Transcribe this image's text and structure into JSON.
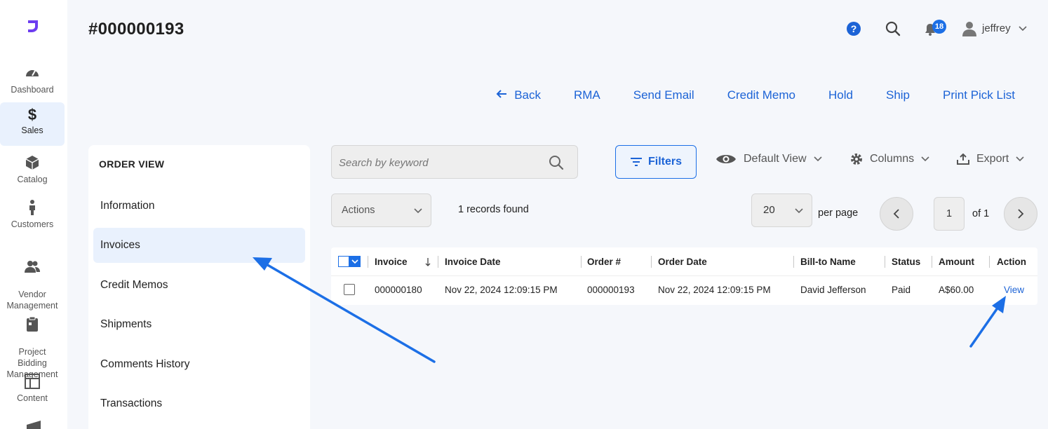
{
  "nav": {
    "items": [
      {
        "label": "Dashboard",
        "icon": "gauge-icon"
      },
      {
        "label": "Sales",
        "icon": "dollar-icon",
        "glyph": "$"
      },
      {
        "label": "Catalog",
        "icon": "box-icon"
      },
      {
        "label": "Customers",
        "icon": "person-icon"
      },
      {
        "label": "Vendor\nManagement",
        "icon": "users-icon"
      },
      {
        "label": "Project\nBidding\nManagement",
        "icon": "clipboard-icon"
      },
      {
        "label": "Content",
        "icon": "layout-icon"
      }
    ]
  },
  "header": {
    "title": "#000000193",
    "notifications_count": "18",
    "user": "jeffrey"
  },
  "actions": {
    "back": "Back",
    "rma": "RMA",
    "send_email": "Send Email",
    "credit_memo": "Credit Memo",
    "hold": "Hold",
    "ship": "Ship",
    "print_pick_list": "Print Pick List"
  },
  "side": {
    "title": "ORDER VIEW",
    "items": [
      "Information",
      "Invoices",
      "Credit Memos",
      "Shipments",
      "Comments History",
      "Transactions"
    ],
    "active": "Invoices"
  },
  "toolbar": {
    "search_placeholder": "Search by keyword",
    "filters": "Filters",
    "default_view": "Default View",
    "columns": "Columns",
    "export": "Export",
    "actions": "Actions",
    "records": "1 records found",
    "per_page_value": "20",
    "per_page_label": "per page",
    "page": "1",
    "of": "of 1"
  },
  "table": {
    "headers": [
      "Invoice",
      "Invoice Date",
      "Order #",
      "Order Date",
      "Bill-to Name",
      "Status",
      "Amount",
      "Action"
    ],
    "rows": [
      {
        "invoice": "000000180",
        "invoice_date": "Nov 22, 2024 12:09:15 PM",
        "order": "000000193",
        "order_date": "Nov 22, 2024 12:09:15 PM",
        "bill_to": "David Jefferson",
        "status": "Paid",
        "amount": "A$60.00",
        "action": "View"
      }
    ]
  },
  "colors": {
    "accent": "#1c63d6",
    "badge": "#1c6fe6",
    "active_bg": "#e9f1fd",
    "annotation_arrow": "#1c6fe6"
  }
}
